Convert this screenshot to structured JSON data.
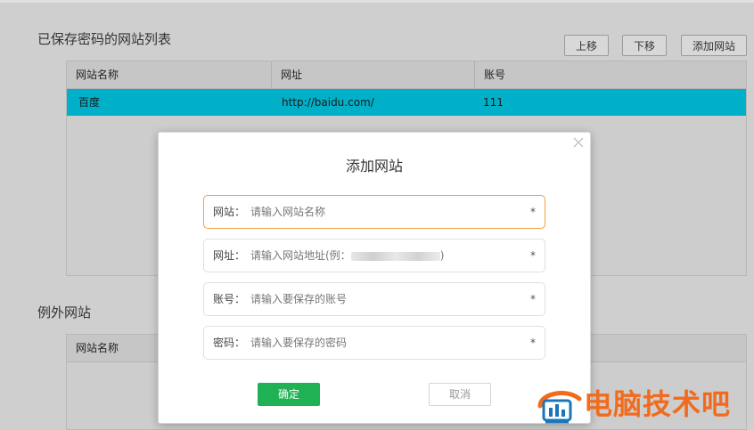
{
  "saved_section": {
    "title": "已保存密码的网站列表",
    "buttons": {
      "up": "上移",
      "down": "下移",
      "add": "添加网站"
    },
    "columns": [
      "网站名称",
      "网址",
      "账号"
    ],
    "rows": [
      {
        "name": "百度",
        "url": "http://baidu.com/",
        "account": "111"
      }
    ]
  },
  "except_section": {
    "title": "例外网站",
    "columns": [
      "网站名称"
    ]
  },
  "modal": {
    "title": "添加网站",
    "fields": [
      {
        "label": "网站：",
        "placeholder": "请输入网站名称",
        "required": "*"
      },
      {
        "label": "网址：",
        "placeholder": "请输入网站地址(例：",
        "placeholder_end": ")",
        "required": "*"
      },
      {
        "label": "账号：",
        "placeholder": "请输入要保存的账号",
        "required": "*"
      },
      {
        "label": "密码：",
        "placeholder": "请输入要保存的密码",
        "required": "*"
      }
    ],
    "ok_label": "确定",
    "cancel_label": "取消"
  },
  "watermark": {
    "text": "电脑技术吧"
  },
  "colors": {
    "selected_row": "#00b0c8",
    "ok_button": "#1fb153",
    "focus_border": "#f0a23a",
    "watermark": "#f26b1d"
  }
}
